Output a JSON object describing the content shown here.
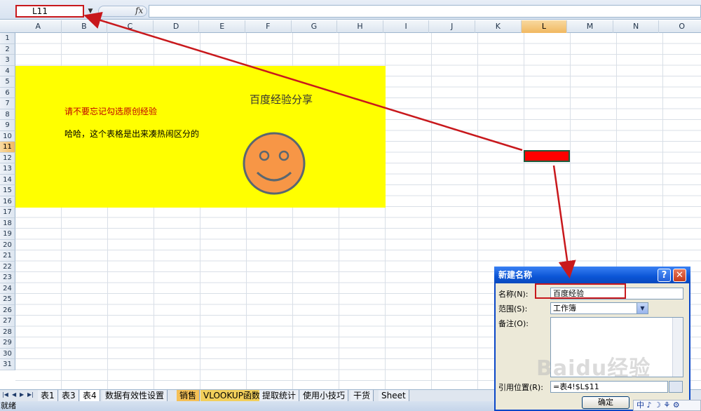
{
  "formula_bar": {
    "name_box": "L11",
    "fx_label": "fx",
    "formula": ""
  },
  "columns": [
    {
      "label": "A"
    },
    {
      "label": "B"
    },
    {
      "label": "C"
    },
    {
      "label": "D"
    },
    {
      "label": "E"
    },
    {
      "label": "F"
    },
    {
      "label": "G"
    },
    {
      "label": "H"
    },
    {
      "label": "I"
    },
    {
      "label": "J"
    },
    {
      "label": "K"
    },
    {
      "label": "L",
      "selected": true
    },
    {
      "label": "M"
    },
    {
      "label": "N"
    },
    {
      "label": "O"
    }
  ],
  "rows": [
    "1",
    "2",
    "3",
    "4",
    "5",
    "6",
    "7",
    "8",
    "9",
    "10",
    "11",
    "12",
    "13",
    "14",
    "15",
    "16",
    "17",
    "18",
    "19",
    "20",
    "21",
    "22",
    "23",
    "24",
    "25",
    "26",
    "27",
    "28",
    "29",
    "30",
    "31"
  ],
  "selected_row": "11",
  "sheet": {
    "title": "百度经验分享",
    "red_note": "请不要忘记勾选原创经验",
    "black_note": "哈哈，这个表格是出来凑热闹区分的",
    "highlight_color": "#ffff00",
    "selected_cell_fill": "#ff0000"
  },
  "sheet_tabs": [
    {
      "label": "表1"
    },
    {
      "label": "表3"
    },
    {
      "label": "表4",
      "active": true
    },
    {
      "label": "数据有效性设置"
    },
    {
      "label": "销售",
      "style": "orange"
    },
    {
      "label": "VLOOKUP函数",
      "style": "gold"
    },
    {
      "label": "提取统计"
    },
    {
      "label": "使用小技巧"
    },
    {
      "label": "干货"
    },
    {
      "label": "Sheet"
    }
  ],
  "status": {
    "text": "就绪"
  },
  "dialog": {
    "title": "新建名称",
    "help": "?",
    "close": "✕",
    "name_label": "名称(N):",
    "name_value": "百度经验",
    "scope_label": "范围(S):",
    "scope_value": "工作簿",
    "comment_label": "备注(O):",
    "ref_label": "引用位置(R):",
    "ref_value": "=表4!$L$11",
    "ok_label": "确定"
  },
  "ime": {
    "text": "中 ♪ ☽ ⚘ ⚙"
  },
  "watermark": "Baidu经验",
  "colors": {
    "annotation": "#c8181c",
    "dialog_title": "#0b55d6"
  }
}
